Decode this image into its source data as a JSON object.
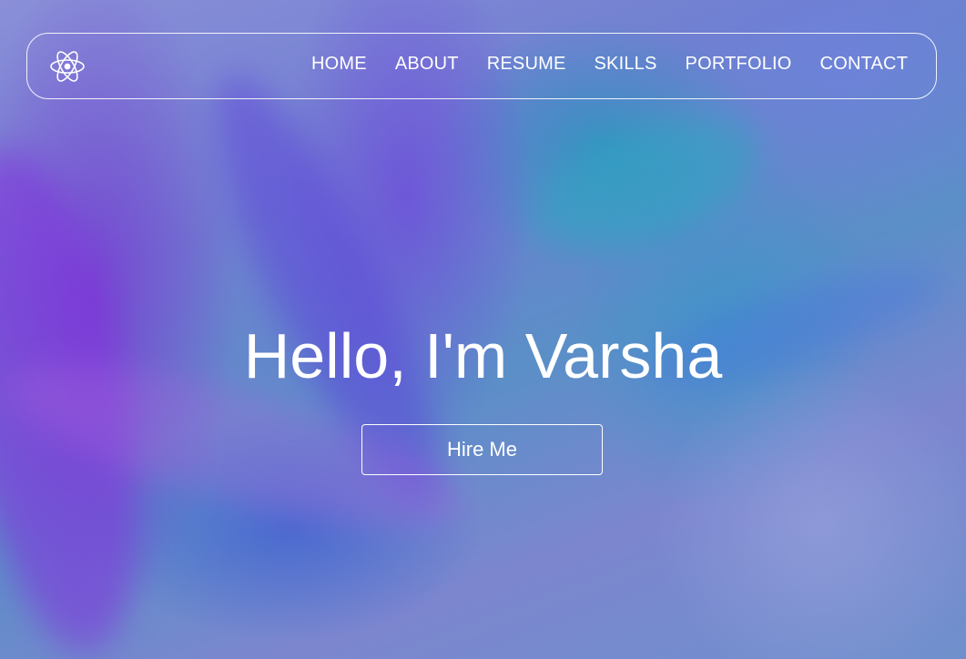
{
  "nav": {
    "logo_icon": "atom-icon",
    "items": [
      {
        "label": "HOME"
      },
      {
        "label": "ABOUT"
      },
      {
        "label": "RESUME"
      },
      {
        "label": "SKILLS"
      },
      {
        "label": "PORTFOLIO"
      },
      {
        "label": "CONTACT"
      }
    ]
  },
  "hero": {
    "title": "Hello, I'm Varsha",
    "cta_label": "Hire Me"
  },
  "colors": {
    "text": "#ffffff",
    "border": "#ffffff",
    "background_primary": "#6f7fd0",
    "background_accent_purple": "#7a3cd2",
    "background_accent_teal": "#2896be"
  }
}
